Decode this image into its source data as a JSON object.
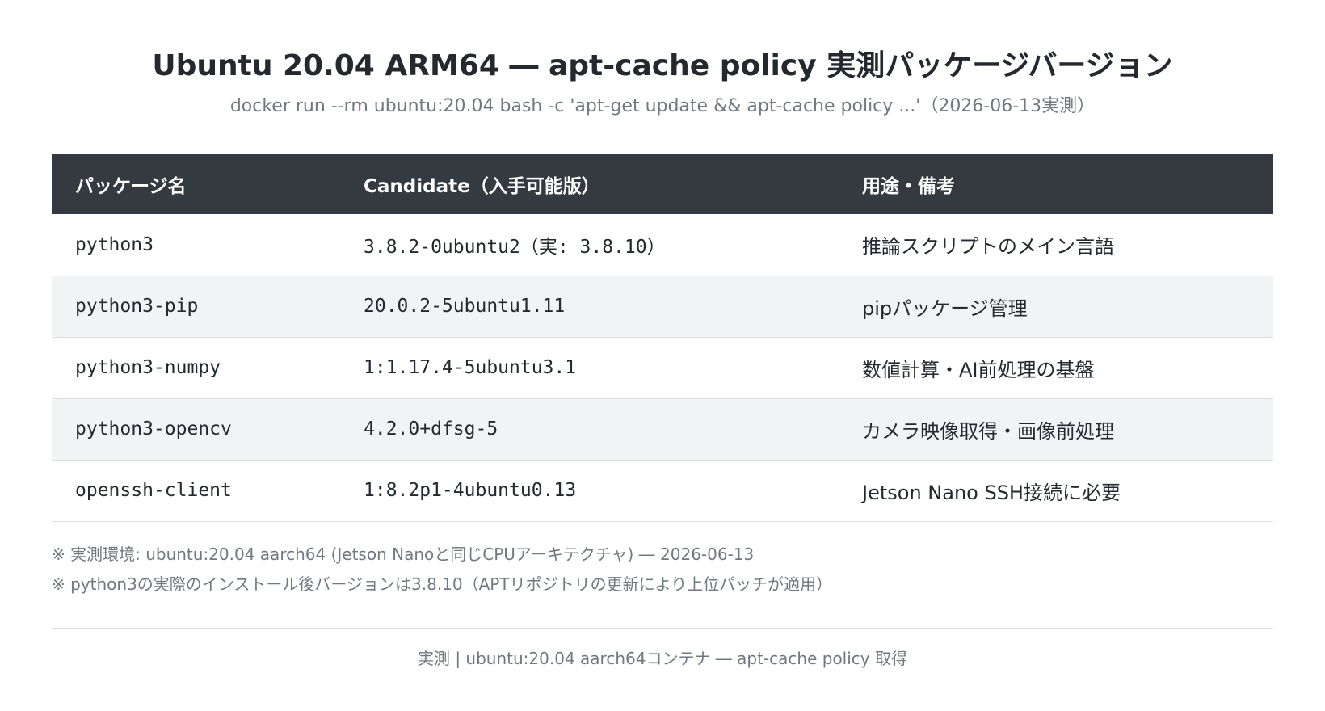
{
  "header": {
    "title": "Ubuntu 20.04 ARM64 ― apt-cache policy 実測パッケージバージョン",
    "subtitle": "docker run --rm ubuntu:20.04 bash -c 'apt-get update && apt-cache policy ...'（2026-06-13実測）"
  },
  "table": {
    "columns": [
      "パッケージ名",
      "Candidate（入手可能版）",
      "用途・備考"
    ],
    "rows": [
      {
        "package": "python3",
        "candidate": "3.8.2-0ubuntu2（実: 3.8.10）",
        "purpose": "推論スクリプトのメイン言語"
      },
      {
        "package": "python3-pip",
        "candidate": "20.0.2-5ubuntu1.11",
        "purpose": "pipパッケージ管理"
      },
      {
        "package": "python3-numpy",
        "candidate": "1:1.17.4-5ubuntu3.1",
        "purpose": "数値計算・AI前処理の基盤"
      },
      {
        "package": "python3-opencv",
        "candidate": "4.2.0+dfsg-5",
        "purpose": "カメラ映像取得・画像前処理"
      },
      {
        "package": "openssh-client",
        "candidate": "1:8.2p1-4ubuntu0.13",
        "purpose": "Jetson Nano SSH接続に必要"
      }
    ]
  },
  "notes": [
    "※ 実測環境: ubuntu:20.04 aarch64 (Jetson Nanoと同じCPUアーキテクチャ) ― 2026-06-13",
    "※ python3の実際のインストール後バージョンは3.8.10（APTリポジトリの更新により上位パッチが適用）"
  ],
  "footer": {
    "text": "実測 | ubuntu:20.04 aarch64コンテナ ― apt-cache policy 取得"
  },
  "colors": {
    "header_bg": "#343a40",
    "alt_row_bg": "#f2f3f5",
    "muted_text": "#707880"
  }
}
